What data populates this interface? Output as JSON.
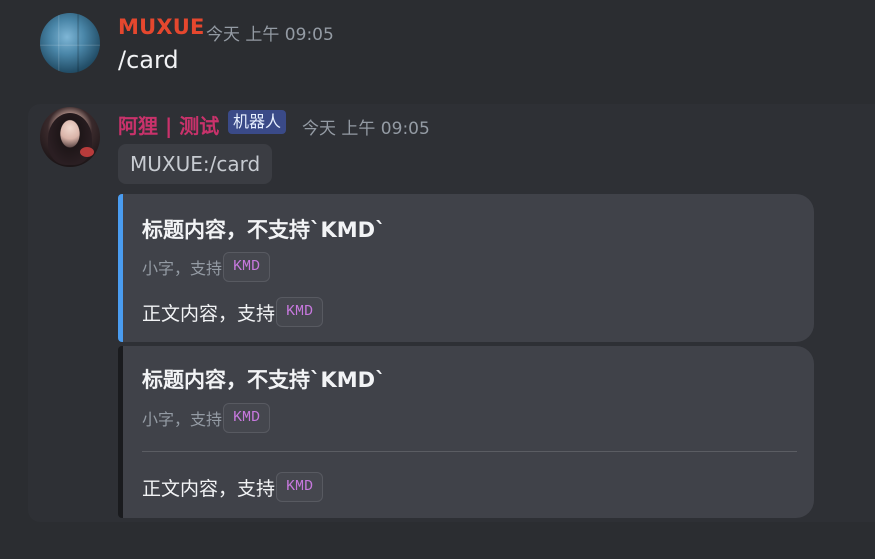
{
  "message1": {
    "author": "MUXUE",
    "author_color": "#e5472e",
    "timestamp": "今天 上午 09:05",
    "text": "/card"
  },
  "message2": {
    "author": "阿狸 | 测试",
    "author_color": "#c9326b",
    "bot_badge": "机器人",
    "timestamp": "今天 上午 09:05",
    "reply_text": "MUXUE:/card",
    "cards": [
      {
        "accent": "#4a9cf0",
        "title": "标题内容，不支持`KMD`",
        "subtitle": "小字，支持",
        "subtitle_code": "KMD",
        "body": "正文内容，支持",
        "body_code": "KMD"
      },
      {
        "accent": "#1a1b1e",
        "title": "标题内容，不支持`KMD`",
        "subtitle": "小字，支持",
        "subtitle_code": "KMD",
        "body": "正文内容，支持",
        "body_code": "KMD"
      }
    ]
  }
}
